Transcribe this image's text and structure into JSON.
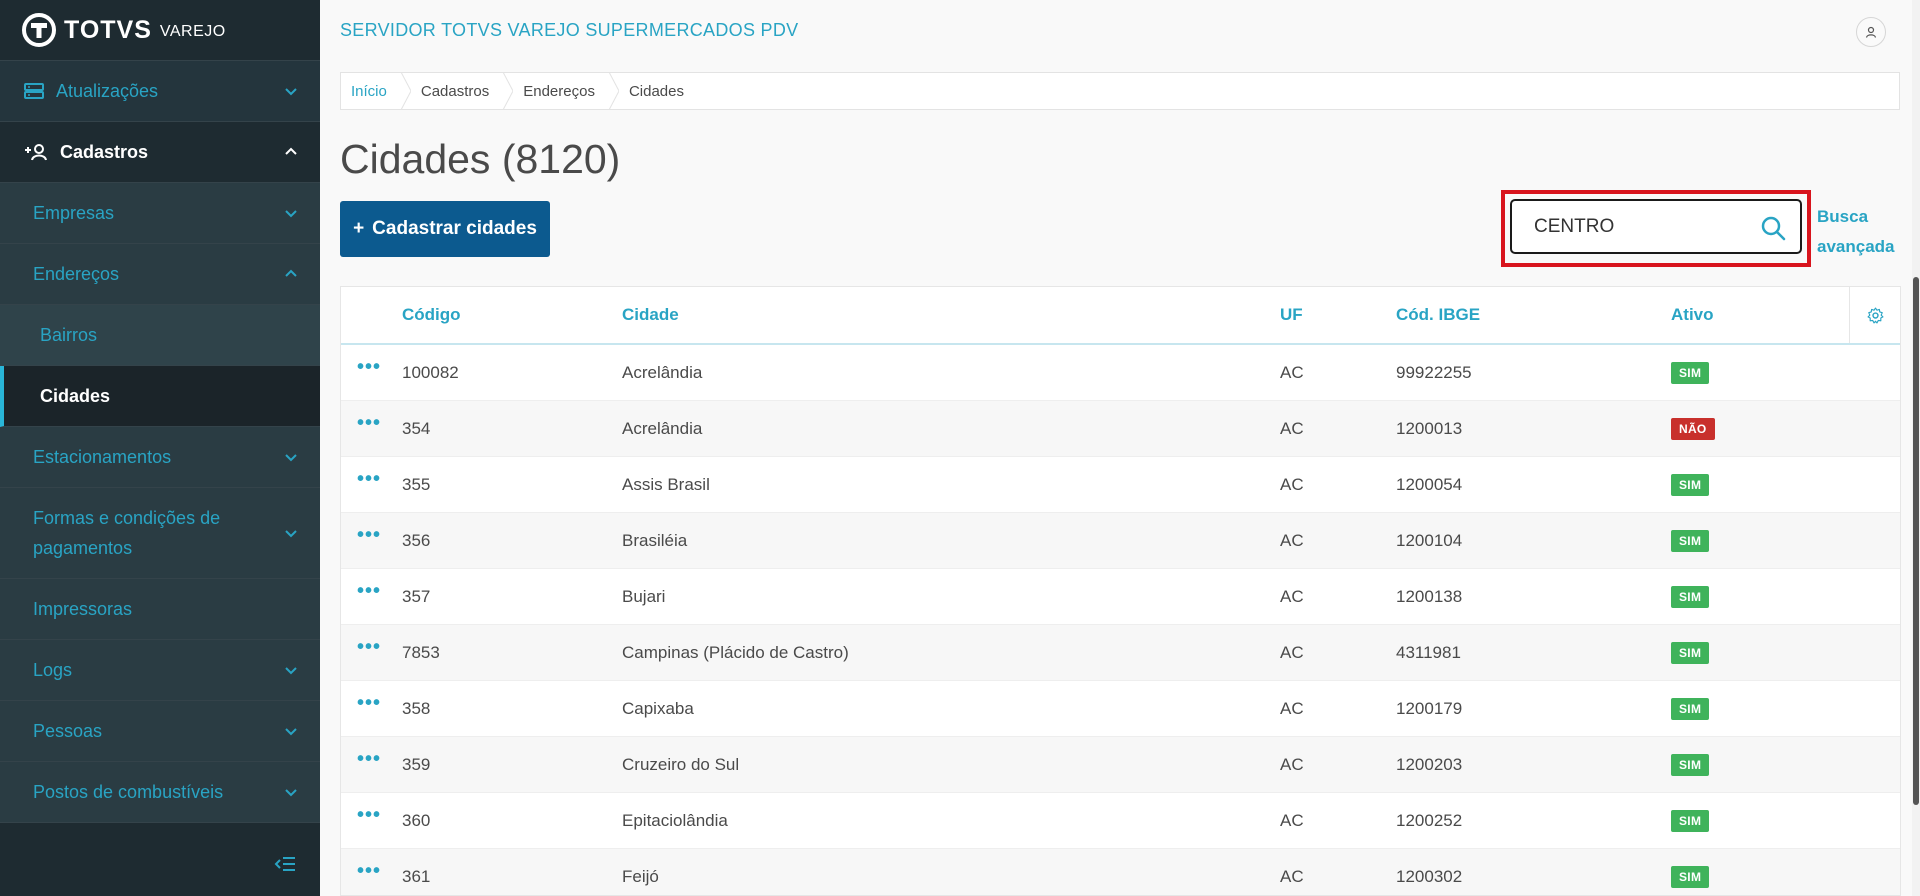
{
  "brand": {
    "name": "TOTVS",
    "sub": "VAREJO"
  },
  "sidebar": {
    "items": [
      {
        "label": "Atualizações",
        "icon": "server-icon"
      },
      {
        "label": "Cadastros",
        "icon": "add-user-icon"
      },
      {
        "label": "Empresas"
      },
      {
        "label": "Endereços"
      },
      {
        "label": "Bairros"
      },
      {
        "label": "Cidades"
      },
      {
        "label": "Estacionamentos"
      },
      {
        "label": "Formas e condições de pagamentos"
      },
      {
        "label": "Impressoras"
      },
      {
        "label": "Logs"
      },
      {
        "label": "Pessoas"
      },
      {
        "label": "Postos de combustíveis"
      }
    ]
  },
  "header": {
    "title": "SERVIDOR TOTVS VAREJO SUPERMERCADOS PDV"
  },
  "breadcrumb": [
    "Início",
    "Cadastros",
    "Endereços",
    "Cidades"
  ],
  "page": {
    "title": "Cidades (8120)",
    "add_button": "Cadastrar cidades"
  },
  "search": {
    "value": "CENTRO",
    "advanced": "Busca avançada"
  },
  "table": {
    "headers": {
      "code": "Código",
      "city": "Cidade",
      "uf": "UF",
      "ibge": "Cód. IBGE",
      "active": "Ativo"
    },
    "rows": [
      {
        "code": "100082",
        "city": "Acrelândia",
        "uf": "AC",
        "ibge": "99922255",
        "active": "SIM"
      },
      {
        "code": "354",
        "city": "Acrelândia",
        "uf": "AC",
        "ibge": "1200013",
        "active": "NÃO"
      },
      {
        "code": "355",
        "city": "Assis Brasil",
        "uf": "AC",
        "ibge": "1200054",
        "active": "SIM"
      },
      {
        "code": "356",
        "city": "Brasiléia",
        "uf": "AC",
        "ibge": "1200104",
        "active": "SIM"
      },
      {
        "code": "357",
        "city": "Bujari",
        "uf": "AC",
        "ibge": "1200138",
        "active": "SIM"
      },
      {
        "code": "7853",
        "city": "Campinas (Plácido de Castro)",
        "uf": "AC",
        "ibge": "4311981",
        "active": "SIM"
      },
      {
        "code": "358",
        "city": "Capixaba",
        "uf": "AC",
        "ibge": "1200179",
        "active": "SIM"
      },
      {
        "code": "359",
        "city": "Cruzeiro do Sul",
        "uf": "AC",
        "ibge": "1200203",
        "active": "SIM"
      },
      {
        "code": "360",
        "city": "Epitaciolândia",
        "uf": "AC",
        "ibge": "1200252",
        "active": "SIM"
      },
      {
        "code": "361",
        "city": "Feijó",
        "uf": "AC",
        "ibge": "1200302",
        "active": "SIM"
      }
    ]
  },
  "colors": {
    "accent": "#29a4c4",
    "sidebar": "#1e2b31",
    "primary_button": "#0c5a8f",
    "sim": "#3fb35b",
    "nao": "#c8302c",
    "highlight": "#d8141d"
  }
}
